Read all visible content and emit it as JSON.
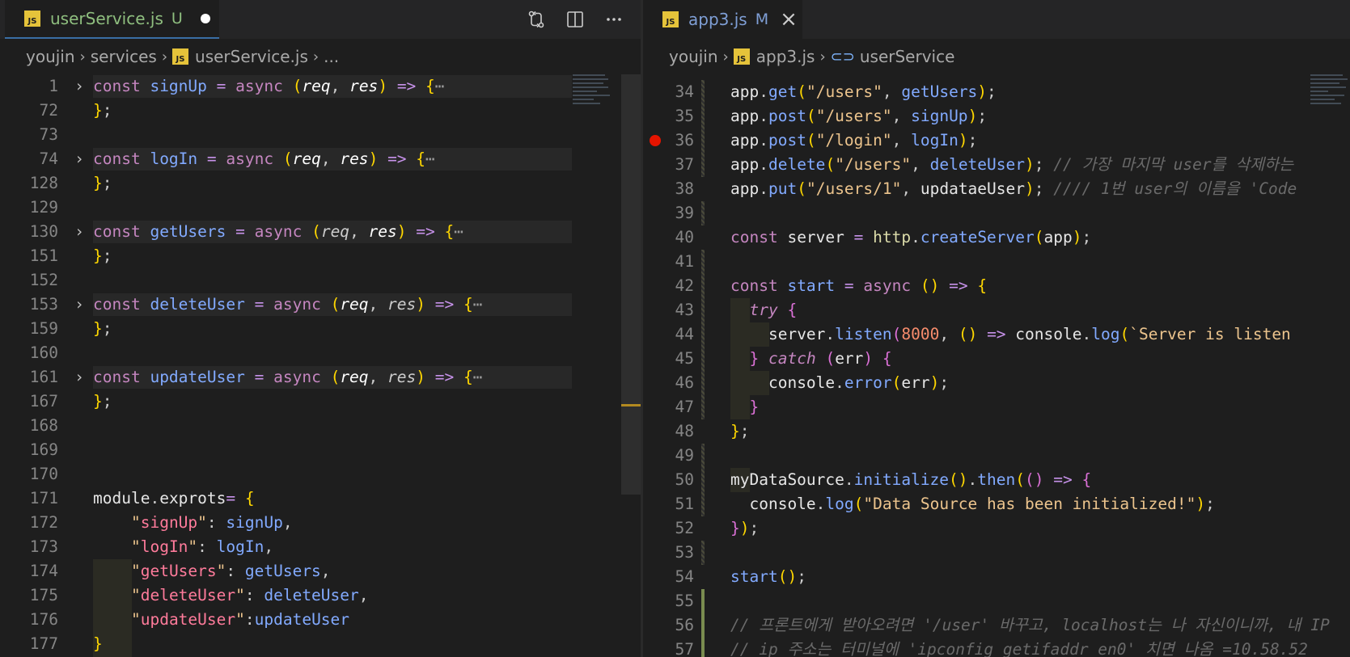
{
  "left": {
    "tab": {
      "name": "userService.js",
      "status": "U",
      "badge": "JS"
    },
    "breadcrumb": [
      "youjin",
      "services",
      "userService.js",
      "..."
    ],
    "lines": [
      {
        "num": "1",
        "folded": true,
        "html": "<span class=\"k\">const</span> <span class=\"fb\">signUp</span> <span class=\"op\">=</span> <span class=\"k\">async</span> <span class=\"p1\">(</span><span class=\"pr\">req</span>, <span class=\"pr\">res</span><span class=\"p1\">)</span> <span class=\"op\">=&gt;</span> <span class=\"p1\">{</span><span class=\"ell\">⋯</span>"
      },
      {
        "num": "72",
        "html": "<span class=\"p1\">}</span>;"
      },
      {
        "num": "73",
        "html": ""
      },
      {
        "num": "74",
        "folded": true,
        "html": "<span class=\"k\">const</span> <span class=\"fb\">logIn</span> <span class=\"op\">=</span> <span class=\"k\">async</span> <span class=\"p1\">(</span><span class=\"pr\">req</span>, <span class=\"pr\">res</span><span class=\"p1\">)</span> <span class=\"op\">=&gt;</span> <span class=\"p1\">{</span><span class=\"ell\">⋯</span>"
      },
      {
        "num": "128",
        "html": "<span class=\"p1\">}</span>;"
      },
      {
        "num": "129",
        "html": ""
      },
      {
        "num": "130",
        "folded": true,
        "html": "<span class=\"k\">const</span> <span class=\"fb\">getUsers</span> <span class=\"op\">=</span> <span class=\"k\">async</span> <span class=\"p1\">(</span><span class=\"i\">req</span>, <span class=\"pr\">res</span><span class=\"p1\">)</span> <span class=\"op\">=&gt;</span> <span class=\"p1\">{</span><span class=\"ell\">⋯</span>"
      },
      {
        "num": "151",
        "html": "<span class=\"p1\">}</span>;"
      },
      {
        "num": "152",
        "html": ""
      },
      {
        "num": "153",
        "folded": true,
        "html": "<span class=\"k\">const</span> <span class=\"fb\">deleteUser</span> <span class=\"op\">=</span> <span class=\"k\">async</span> <span class=\"p1\">(</span><span class=\"pr\">req</span>, <span class=\"i\">res</span><span class=\"p1\">)</span> <span class=\"op\">=&gt;</span> <span class=\"p1\">{</span><span class=\"ell\">⋯</span>"
      },
      {
        "num": "159",
        "html": "<span class=\"p1\">}</span>;"
      },
      {
        "num": "160",
        "html": ""
      },
      {
        "num": "161",
        "folded": true,
        "html": "<span class=\"k\">const</span> <span class=\"fb\">updateUser</span> <span class=\"op\">=</span> <span class=\"k\">async</span> <span class=\"p1\">(</span><span class=\"pr\">req</span>, <span class=\"i\">res</span><span class=\"p1\">)</span> <span class=\"op\">=&gt;</span> <span class=\"p1\">{</span><span class=\"ell\">⋯</span>"
      },
      {
        "num": "167",
        "html": "<span class=\"p1\">}</span>;"
      },
      {
        "num": "168",
        "html": ""
      },
      {
        "num": "169",
        "html": ""
      },
      {
        "num": "170",
        "html": ""
      },
      {
        "num": "171",
        "html": "<span class=\"w\">module</span>.<span class=\"w\">exprots</span><span class=\"op\">=</span> <span class=\"p1\">{</span>"
      },
      {
        "num": "172",
        "html": "    <span class=\"s\">\"</span><span class=\"sr\">signUp</span><span class=\"s\">\"</span>: <span class=\"fb\">signUp</span>,"
      },
      {
        "num": "173",
        "html": "    <span class=\"s\">\"</span><span class=\"sr\">logIn</span><span class=\"s\">\"</span>: <span class=\"fb\">logIn</span>,"
      },
      {
        "num": "174",
        "html": "    <span class=\"s\">\"</span><span class=\"sr\">getUsers</span><span class=\"s\">\"</span>: <span class=\"fb\">getUsers</span>,"
      },
      {
        "num": "175",
        "html": "    <span class=\"s\">\"</span><span class=\"sr\">deleteUser</span><span class=\"s\">\"</span>: <span class=\"fb\">deleteUser</span>,"
      },
      {
        "num": "176",
        "html": "    <span class=\"s\">\"</span><span class=\"sr\">updateUser</span><span class=\"s\">\"</span>:<span class=\"fb\">updateUser</span>"
      },
      {
        "num": "177",
        "html": "<span class=\"p1\">}</span>"
      }
    ]
  },
  "right": {
    "tab": {
      "name": "app3.js",
      "status": "M",
      "badge": "JS"
    },
    "breadcrumb": [
      "youjin",
      "app3.js",
      "userService"
    ],
    "lines": [
      {
        "num": "34",
        "html": "<span class=\"w\">app</span>.<span class=\"fb\">get</span><span class=\"p1\">(</span><span class=\"s\">\"/users\"</span>, <span class=\"fb\">getUsers</span><span class=\"p1\">)</span>;"
      },
      {
        "num": "35",
        "html": "<span class=\"w\">app</span>.<span class=\"fb\">post</span><span class=\"p1\">(</span><span class=\"s\">\"/users\"</span>, <span class=\"fb\">signUp</span><span class=\"p1\">)</span>;"
      },
      {
        "num": "36",
        "breakpoint": true,
        "html": "<span class=\"w\">app</span>.<span class=\"fb\">post</span><span class=\"p1\">(</span><span class=\"s\">\"/login\"</span>, <span class=\"fb\">logIn</span><span class=\"p1\">)</span>;"
      },
      {
        "num": "37",
        "html": "<span class=\"w\">app</span>.<span class=\"fb\">delete</span><span class=\"p1\">(</span><span class=\"s\">\"/users\"</span>, <span class=\"fb\">deleteUser</span><span class=\"p1\">)</span>; <span class=\"c\">// 가장 마지막 user를 삭제하는</span>"
      },
      {
        "num": "38",
        "html": "<span class=\"w\">app</span>.<span class=\"fb\">put</span><span class=\"p1\">(</span><span class=\"s\">\"/users/1\"</span>, <span class=\"w\">updataeUser</span><span class=\"p1\">)</span>; <span class=\"c\">//// 1번 user의 이름을 'Code</span>"
      },
      {
        "num": "39",
        "html": ""
      },
      {
        "num": "40",
        "html": "<span class=\"k\">const</span> <span class=\"w\">server</span> <span class=\"op\">=</span> <span class=\"f\">http</span>.<span class=\"fb\">createServer</span><span class=\"p1\">(</span><span class=\"w\">app</span><span class=\"p1\">)</span>;"
      },
      {
        "num": "41",
        "html": ""
      },
      {
        "num": "42",
        "html": "<span class=\"k\">const</span> <span class=\"fb\">start</span> <span class=\"op\">=</span> <span class=\"k\">async</span> <span class=\"p1\">()</span> <span class=\"op\">=&gt;</span> <span class=\"p1\">{</span>"
      },
      {
        "num": "43",
        "html": "  <span class=\"st i\">try</span> <span class=\"p2\">{</span>"
      },
      {
        "num": "44",
        "html": "    <span class=\"w\">server</span>.<span class=\"fb\">listen</span><span class=\"p2\">(</span><span class=\"n\">8000</span>, <span class=\"p1\">()</span> <span class=\"op\">=&gt;</span> <span class=\"w\">console</span>.<span class=\"fb\">log</span><span class=\"p1\">(</span><span class=\"s\">`Server is listen</span>"
      },
      {
        "num": "45",
        "html": "  <span class=\"p2\">}</span> <span class=\"st i\">catch</span> <span class=\"p2\">(</span><span class=\"w\">err</span><span class=\"p2\">)</span> <span class=\"p2\">{</span>"
      },
      {
        "num": "46",
        "html": "    <span class=\"w\">console</span>.<span class=\"fb\">error</span><span class=\"p1\">(</span><span class=\"w\">err</span><span class=\"p1\">)</span>;"
      },
      {
        "num": "47",
        "html": "  <span class=\"p2\">}</span>"
      },
      {
        "num": "48",
        "html": "<span class=\"p1\">}</span>;"
      },
      {
        "num": "49",
        "html": ""
      },
      {
        "num": "50",
        "html": "<span class=\"w\">myDataSource</span>.<span class=\"fb\">initialize</span><span class=\"p1\">()</span>.<span class=\"fb\">then</span><span class=\"p1\">(</span><span class=\"p2\">()</span> <span class=\"op\">=&gt;</span> <span class=\"p2\">{</span>"
      },
      {
        "num": "51",
        "html": "  <span class=\"w\">console</span>.<span class=\"fb\">log</span><span class=\"p1\">(</span><span class=\"s\">\"Data Source has been initialized!\"</span><span class=\"p1\">)</span>;"
      },
      {
        "num": "52",
        "html": "<span class=\"p2\">}</span><span class=\"p1\">)</span>;"
      },
      {
        "num": "53",
        "html": ""
      },
      {
        "num": "54",
        "html": "<span class=\"fb\">start</span><span class=\"p1\">()</span>;"
      },
      {
        "num": "55",
        "html": ""
      },
      {
        "num": "56",
        "html": "<span class=\"c\">// 프론트에게 받아오려면 '/user' 바꾸고, localhost는 나 자신이니까, 내 IP</span>"
      },
      {
        "num": "57",
        "html": "<span class=\"c\">// ip 주소는 터미널에 'ipconfig getifaddr en0' 치면 나옴 =10.58.52</span>"
      }
    ]
  },
  "colors": {
    "accent_tab_underline": "#3a6ea5",
    "breakpoint": "#e51400",
    "js_badge": "#e5c33a"
  }
}
